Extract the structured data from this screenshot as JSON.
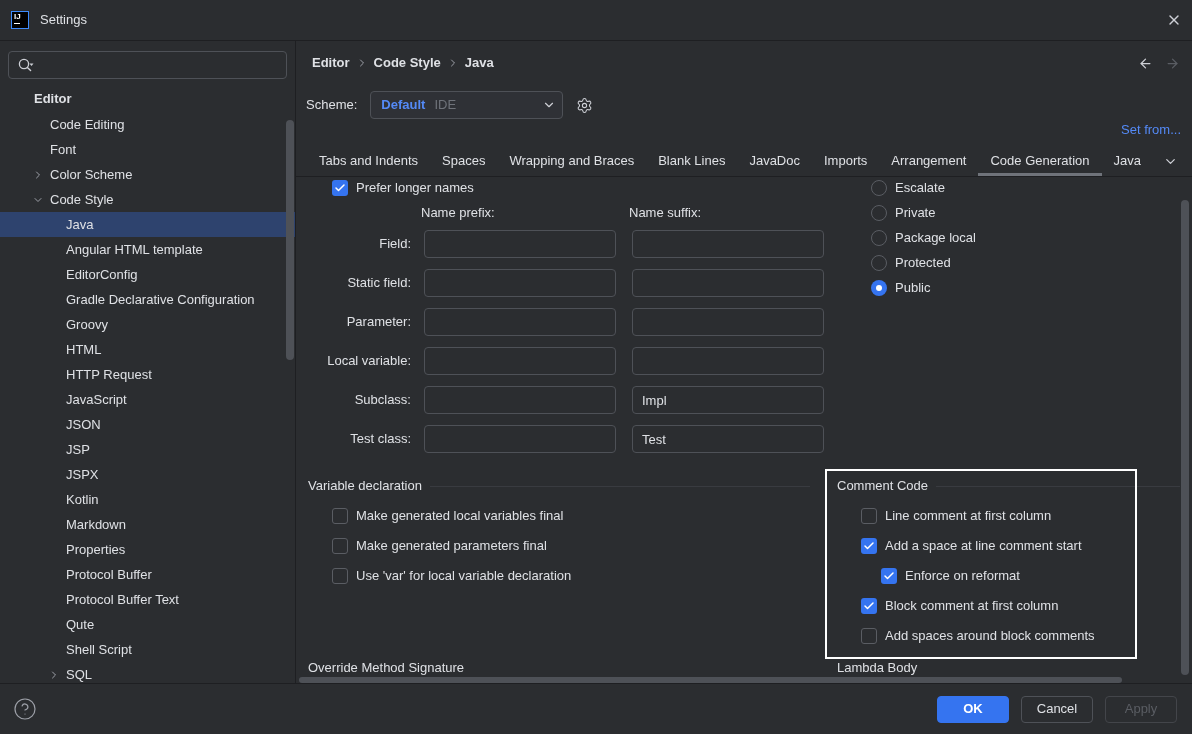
{
  "window": {
    "title": "Settings",
    "logo_text": "IJ"
  },
  "sidebar": {
    "tree": [
      {
        "label": "Editor",
        "selected": false,
        "children": [
          {
            "label": "Code Editing",
            "selected": false
          },
          {
            "label": "Font",
            "selected": false
          },
          {
            "label": "Color Scheme",
            "selected": false,
            "expanded": false
          },
          {
            "label": "Code Style",
            "selected": false,
            "expanded": true,
            "children": [
              {
                "label": "Java",
                "selected": true
              },
              {
                "label": "Angular HTML template",
                "selected": false
              },
              {
                "label": "EditorConfig",
                "selected": false
              },
              {
                "label": "Gradle Declarative Configuration",
                "selected": false
              },
              {
                "label": "Groovy",
                "selected": false
              },
              {
                "label": "HTML",
                "selected": false
              },
              {
                "label": "HTTP Request",
                "selected": false
              },
              {
                "label": "JavaScript",
                "selected": false
              },
              {
                "label": "JSON",
                "selected": false
              },
              {
                "label": "JSP",
                "selected": false
              },
              {
                "label": "JSPX",
                "selected": false
              },
              {
                "label": "Kotlin",
                "selected": false
              },
              {
                "label": "Markdown",
                "selected": false
              },
              {
                "label": "Properties",
                "selected": false
              },
              {
                "label": "Protocol Buffer",
                "selected": false
              },
              {
                "label": "Protocol Buffer Text",
                "selected": false
              },
              {
                "label": "Qute",
                "selected": false
              },
              {
                "label": "Shell Script",
                "selected": false
              },
              {
                "label": "SQL",
                "selected": false,
                "expanded": false
              }
            ]
          }
        ]
      }
    ]
  },
  "breadcrumbs": [
    "Editor",
    "Code Style",
    "Java"
  ],
  "navigation": {
    "back_disabled": false,
    "forward_disabled": true
  },
  "scheme": {
    "label": "Scheme:",
    "name": "Default",
    "type": "IDE"
  },
  "set_from_link": "Set from...",
  "tabs": [
    {
      "label": "Tabs and Indents",
      "selected": false
    },
    {
      "label": "Spaces",
      "selected": false
    },
    {
      "label": "Wrapping and Braces",
      "selected": false
    },
    {
      "label": "Blank Lines",
      "selected": false
    },
    {
      "label": "JavaDoc",
      "selected": false
    },
    {
      "label": "Imports",
      "selected": false
    },
    {
      "label": "Arrangement",
      "selected": false
    },
    {
      "label": "Code Generation",
      "selected": true
    },
    {
      "label": "Java",
      "selected": false
    }
  ],
  "naming": {
    "prefer_longer_names": {
      "label": "Prefer longer names",
      "checked": true
    },
    "columns": [
      "Name prefix:",
      "Name suffix:"
    ],
    "rows": [
      {
        "label": "Field:"
      },
      {
        "label": "Static field:"
      },
      {
        "label": "Parameter:"
      },
      {
        "label": "Local variable:"
      },
      {
        "label": "Subclass:",
        "suffix": "Impl"
      },
      {
        "label": "Test class:",
        "suffix": "Test"
      }
    ]
  },
  "visibility": [
    {
      "label": "Escalate",
      "selected": false
    },
    {
      "label": "Private",
      "selected": false
    },
    {
      "label": "Package local",
      "selected": false
    },
    {
      "label": "Protected",
      "selected": false
    },
    {
      "label": "Public",
      "selected": true
    }
  ],
  "variable_declaration": {
    "title": "Variable declaration",
    "options": [
      {
        "label": "Make generated local variables final",
        "checked": false
      },
      {
        "label": "Make generated parameters final",
        "checked": false
      },
      {
        "label": "Use 'var' for local variable declaration",
        "checked": false
      }
    ]
  },
  "comment_code": {
    "title": "Comment Code",
    "highlighted": true,
    "options": [
      {
        "label": "Line comment at first column",
        "checked": false
      },
      {
        "label": "Add a space at line comment start",
        "checked": true,
        "children": [
          {
            "label": "Enforce on reformat",
            "checked": true
          }
        ]
      },
      {
        "label": "Block comment at first column",
        "checked": true
      },
      {
        "label": "Add spaces around block comments",
        "checked": false
      }
    ]
  },
  "more_sections": [
    "Override Method Signature",
    "Lambda Body"
  ],
  "buttons": [
    {
      "label": "OK",
      "kind": "primary",
      "disabled": false
    },
    {
      "label": "Cancel",
      "kind": "secondary",
      "disabled": false
    },
    {
      "label": "Apply",
      "kind": "secondary",
      "disabled": true
    }
  ]
}
